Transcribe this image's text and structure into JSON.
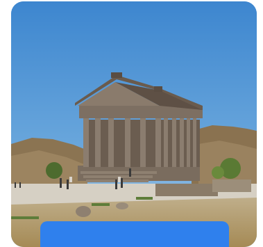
{
  "card": {
    "image_subject": "temple-photo",
    "colors": {
      "sky": "#4a8fd0",
      "button": "#2f80ed"
    }
  },
  "cta": {
    "label": ""
  }
}
